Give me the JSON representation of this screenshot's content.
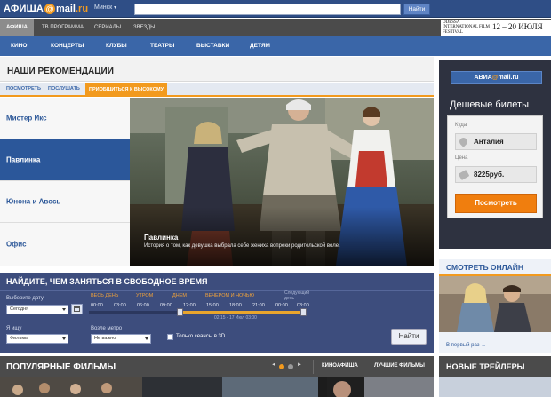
{
  "header": {
    "logo": {
      "afisha": "АФИША",
      "at": "@",
      "mail": "mail",
      "dot_ru": ".ru"
    },
    "city": "Минск",
    "search": {
      "placeholder": "",
      "value": ""
    },
    "search_button": "Найти"
  },
  "section_tabs": [
    {
      "label": "АФИША",
      "active": true
    },
    {
      "label": "ТВ ПРОГРАММА"
    },
    {
      "label": "СЕРИАЛЫ"
    },
    {
      "label": "ЗВЕЗДЫ"
    }
  ],
  "festival_banner": {
    "name": "ODESSA INTERNATIONAL FILM FESTIVAL",
    "dates": "12 – 20 ИЮЛЯ"
  },
  "category_nav": [
    "КИНО",
    "КОНЦЕРТЫ",
    "КЛУБЫ",
    "ТЕАТРЫ",
    "ВЫСТАВКИ",
    "ДЕТЯМ"
  ],
  "recommendations": {
    "title": "НАШИ РЕКОМЕНДАЦИИ",
    "tabs": [
      {
        "label": "ПОСМОТРЕТЬ"
      },
      {
        "label": "ПОСЛУШАТЬ"
      },
      {
        "label": "ПРИОБЩИТЬСЯ К ВЫСОКОМУ",
        "active": true
      }
    ],
    "items": [
      {
        "label": "Мистер Икс"
      },
      {
        "label": "Павлинка",
        "active": true
      },
      {
        "label": "Юнона и Авось"
      },
      {
        "label": "Офис"
      }
    ],
    "featured": {
      "title": "Павлинка",
      "description": "История о том, как девушка выбрала себе жениха вопреки родительской воле."
    }
  },
  "free_time": {
    "title": "НАЙДИТЕ, ЧЕМ ЗАНЯТЬСЯ В СВОБОДНОЕ ВРЕМЯ",
    "date_label": "Выберите дату",
    "date_value": "Сегодня",
    "periods": [
      "ВЕСЬ ДЕНЬ",
      "УТРОМ",
      "ДНЕМ",
      "ВЕЧЕРОМ И НОЧЬЮ"
    ],
    "next_day": "Следующий день",
    "times": [
      "00:00",
      "03:00",
      "06:00",
      "09:00",
      "12:00",
      "15:00",
      "18:00",
      "21:00",
      "00:00",
      "03:00"
    ],
    "range_text": "02:15 - 17 Июл 03:00",
    "range_start_fraction": 0.42,
    "range_end_fraction": 1.0,
    "want_label": "Я ищу",
    "want_value": "Фильмы",
    "metro_label": "Возле метро",
    "metro_value": "Не важно",
    "only_3d_label": "Только сеансы в 3D",
    "only_3d_checked": false,
    "find_button": "Найти"
  },
  "popular": {
    "title": "ПОПУЛЯРНЫЕ ФИЛЬМЫ",
    "prev": "◄",
    "next": "►",
    "links": [
      "КИНОАФИША",
      "ЛУЧШИЕ ФИЛЬМЫ"
    ]
  },
  "avia": {
    "logo": {
      "avia": "АВИА",
      "at": "@",
      "mail": "mail.ru"
    },
    "headline": "Дешевые билеты",
    "to_label": "Куда",
    "to_value": "Анталия",
    "price_label": "Цена",
    "price_value": "8225руб.",
    "submit": "Посмотреть"
  },
  "watch_online": {
    "title": "СМОТРЕТЬ ОНЛАЙН",
    "link": "В первый раз →"
  },
  "trailers": {
    "title": "НОВЫЕ ТРЕЙЛЕРЫ"
  },
  "colors": {
    "brand_blue": "#3a66a8",
    "accent_orange": "#f29a1e",
    "panel_navy": "#3d4d7d"
  }
}
